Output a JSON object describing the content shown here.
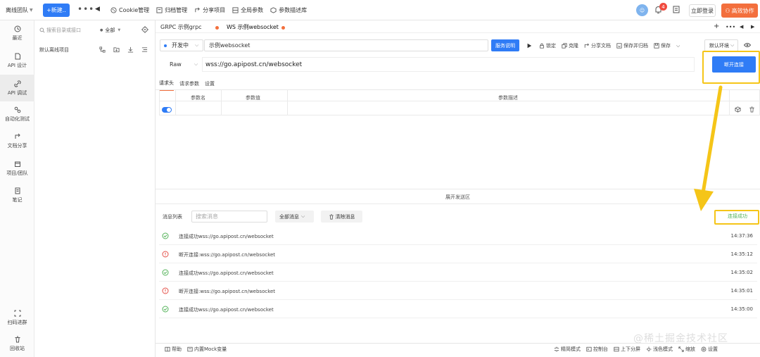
{
  "topbar": {
    "team": "离线团队",
    "new_button": "+新建..",
    "nav": [
      {
        "label": "Cookie管理",
        "icon": "cookie-icon"
      },
      {
        "label": "归档管理",
        "icon": "archive-icon"
      },
      {
        "label": "分享项目",
        "icon": "share-icon"
      },
      {
        "label": "全局参数",
        "icon": "globe-icon"
      },
      {
        "label": "参数描述库",
        "icon": "cube-icon"
      }
    ],
    "avatar_text": "☺",
    "notification_count": "4",
    "login_button": "立即登录",
    "collab_button": "高效协作"
  },
  "sidebar": {
    "items": [
      {
        "label": "最近"
      },
      {
        "label": "API 设计"
      },
      {
        "label": "API 调试"
      },
      {
        "label": "自动化测试"
      },
      {
        "label": "文档分享"
      },
      {
        "label": "项目/团队"
      },
      {
        "label": "笔记"
      }
    ],
    "bottom": [
      {
        "label": "扫码进群"
      },
      {
        "label": "回收站"
      }
    ]
  },
  "tree": {
    "search_placeholder": "搜索目录或接口",
    "scope": "全部",
    "root": "默认离线项目"
  },
  "tabs": [
    {
      "label": "GRPC 示例grpc"
    },
    {
      "label": "WS 示例websocket"
    }
  ],
  "request": {
    "env": "开发中",
    "name": "示例websocket",
    "service_button": "服务说明",
    "toolbar": [
      {
        "label": "锁定"
      },
      {
        "label": "克隆"
      },
      {
        "label": "分享文档"
      },
      {
        "label": "保存并归档"
      },
      {
        "label": "保存"
      }
    ],
    "env_select": "默认环境",
    "method": "Raw",
    "url": "wss://go.apipost.cn/websocket",
    "disconnect_button": "断开连接",
    "subtabs": [
      "请求头",
      "请求参数",
      "设置"
    ],
    "params_headers": [
      "参数名",
      "参数值",
      "参数描述"
    ]
  },
  "expand_label": "展开发送区",
  "messages": {
    "label": "消息列表",
    "search_placeholder": "搜索消息",
    "filter": "全部消息",
    "clear_button": "清除消息",
    "status": "连接成功",
    "items": [
      {
        "type": "success",
        "text": "连接成功wss://go.apipost.cn/websocket",
        "time": "14:37:36"
      },
      {
        "type": "error",
        "text": "断开连接:wss://go.apipost.cn/websocket",
        "time": "14:35:12"
      },
      {
        "type": "success",
        "text": "连接成功wss://go.apipost.cn/websocket",
        "time": "14:35:02"
      },
      {
        "type": "error",
        "text": "断开连接:wss://go.apipost.cn/websocket",
        "time": "14:35:01"
      },
      {
        "type": "success",
        "text": "连接成功wss://go.apipost.cn/websocket",
        "time": "14:35:00"
      }
    ]
  },
  "bottombar": {
    "left": [
      {
        "label": "帮助"
      },
      {
        "label": "内置Mock变量"
      }
    ],
    "right": [
      {
        "label": "精简模式"
      },
      {
        "label": "控制台"
      },
      {
        "label": "上下分屏"
      },
      {
        "label": "浅色模式"
      },
      {
        "label": "缩放"
      },
      {
        "label": "设置"
      }
    ]
  },
  "watermark": "@稀土掘金技术社区",
  "colors": {
    "accent": "#2f7cf6",
    "brand_orange": "#f36f3d",
    "highlight": "#f5c518",
    "success": "#54b35a",
    "error": "#e5534b"
  }
}
